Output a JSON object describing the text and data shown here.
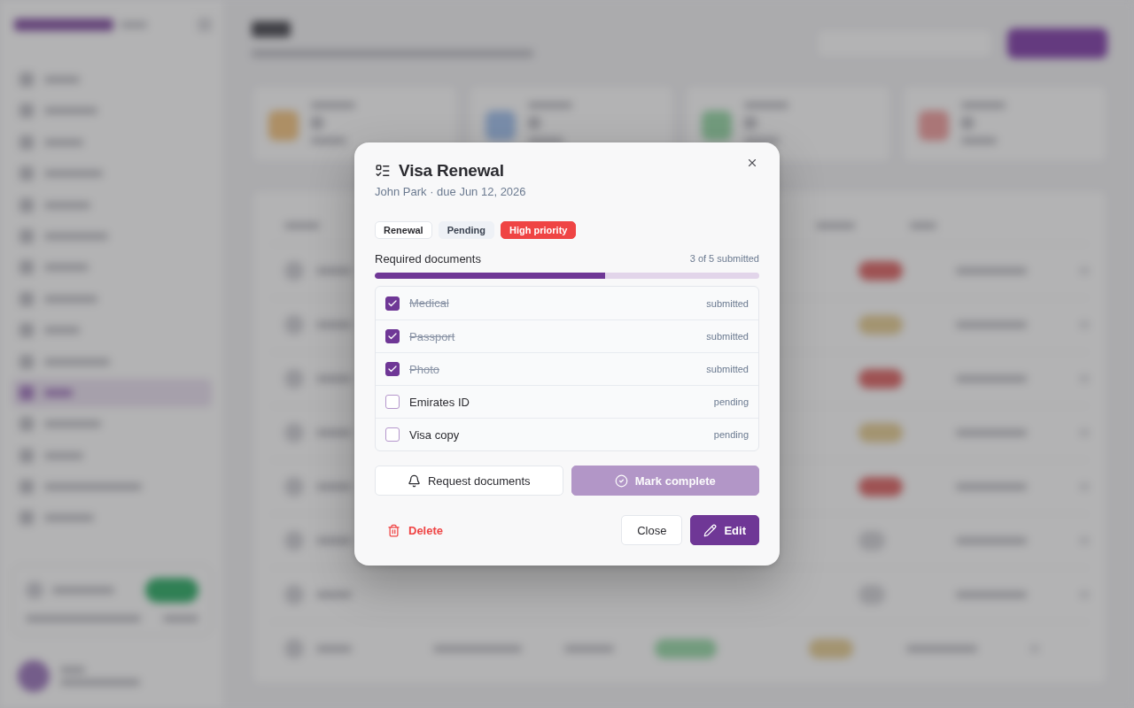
{
  "backdrop": {
    "blurred": true
  },
  "dialog": {
    "title": "Visa Renewal",
    "subtitle": "John Park · due Jun 12, 2026",
    "tags": [
      {
        "label": "Renewal",
        "kind": "outline"
      },
      {
        "label": "Pending",
        "kind": "muted"
      },
      {
        "label": "High priority",
        "kind": "danger"
      }
    ],
    "progress": {
      "label": "Required documents",
      "reading": "3 of 5 submitted",
      "level": 0.6
    },
    "documents": [
      {
        "name": "Medical",
        "status": "submitted",
        "checked": true
      },
      {
        "name": "Passport",
        "status": "submitted",
        "checked": true
      },
      {
        "name": "Photo",
        "status": "submitted",
        "checked": true
      },
      {
        "name": "Emirates ID",
        "status": "pending",
        "checked": false
      },
      {
        "name": "Visa copy",
        "status": "pending",
        "checked": false
      }
    ],
    "actions": [
      {
        "label": "Request documents",
        "kind": "secondary",
        "disabled": false
      },
      {
        "label": "Mark complete",
        "kind": "primary",
        "disabled": true
      }
    ],
    "footer": {
      "delete": {
        "label": "Delete"
      },
      "buttons": [
        {
          "label": "Close",
          "kind": "secondary"
        },
        {
          "label": "Edit",
          "kind": "primary"
        }
      ]
    }
  }
}
